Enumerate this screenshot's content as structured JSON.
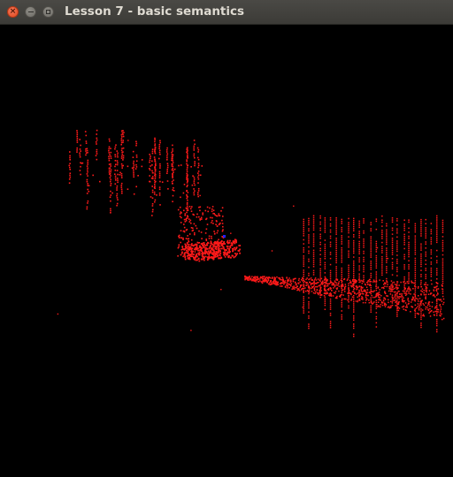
{
  "window": {
    "title": "Lesson 7 - basic semantics",
    "controls": {
      "close_glyph": "×",
      "minimize_icon": "minimize-icon",
      "maximize_icon": "maximize-icon"
    }
  },
  "viewport": {
    "background": "#000000",
    "point_color": "#ff1a1a",
    "marker_color": "#2222ff",
    "content": "point-cloud"
  }
}
